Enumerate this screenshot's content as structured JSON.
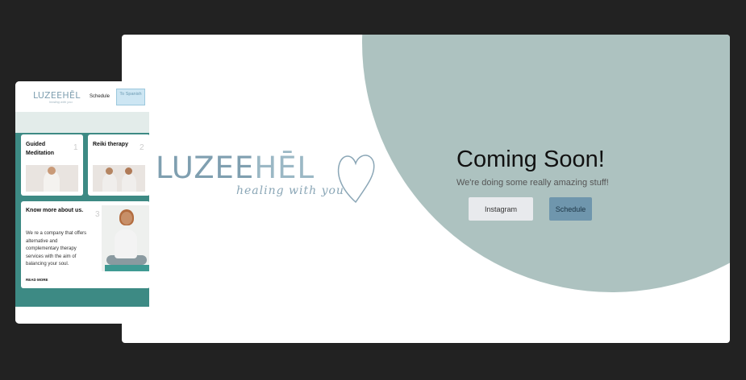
{
  "desktop": {
    "logo_word_dark": "LUZEE",
    "logo_word_light": "HĒL",
    "logo_tagline": "healing with you",
    "title": "Coming Soon!",
    "subtitle": "We're doing some really amazing stuff!",
    "instagram_label": "Instagram",
    "schedule_label": "Schedule",
    "colors": {
      "blob": "#adc2c0",
      "schedule_button": "#6f96ad",
      "instagram_button": "#e8eaed"
    }
  },
  "mobile": {
    "logo": "LUZEEHĒL",
    "logo_tagline": "healing with you",
    "nav_schedule": "Schedule",
    "to_spanish": "To Spanish",
    "cards": [
      {
        "title": "Guided Meditation",
        "number": "1"
      },
      {
        "title": "Reiki therapy",
        "number": "2"
      }
    ],
    "about": {
      "title": "Know more about us.",
      "number": "3",
      "body": "We re a company that offers alternative and complementary therapy services with the aim of balancing your soul.",
      "read_more": "READ MORE"
    },
    "colors": {
      "hero": "#3d8a84"
    }
  }
}
